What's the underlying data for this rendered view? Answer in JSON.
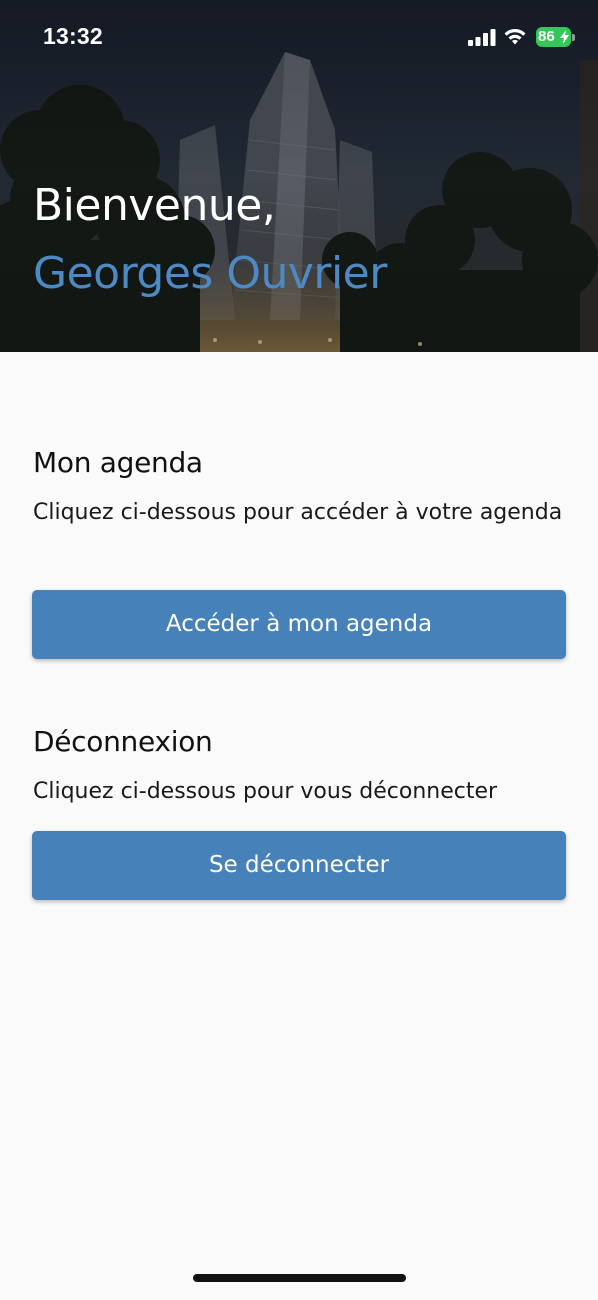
{
  "status_bar": {
    "time": "13:32",
    "battery_level": "86",
    "icons": [
      "signal-icon",
      "wifi-icon",
      "battery-icon",
      "charging-bolt-icon"
    ]
  },
  "header": {
    "greeting": "Bienvenue,",
    "user_name": "Georges Ouvrier"
  },
  "agenda": {
    "title": "Mon agenda",
    "description": "Cliquez ci-dessous pour accéder à votre agenda",
    "button_label": "Accéder à mon agenda"
  },
  "logout": {
    "title": "Déconnexion",
    "description": "Cliquez ci-dessous pour vous déconnecter",
    "button_label": "Se déconnecter"
  },
  "colors": {
    "accent": "#4682b9",
    "user_name": "#4d8ac4",
    "background": "#fafafa",
    "battery": "#34c759"
  }
}
